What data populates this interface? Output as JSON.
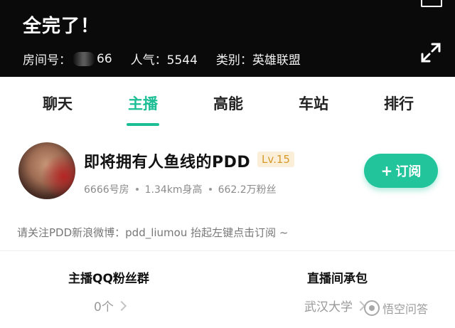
{
  "header": {
    "title": "全完了！",
    "room_label": "房间号：",
    "room_suffix": "66",
    "popularity": "人气：5544",
    "category": "类别：英雄联盟"
  },
  "tabs": [
    {
      "label": "聊天"
    },
    {
      "label": "主播"
    },
    {
      "label": "高能"
    },
    {
      "label": "车站"
    },
    {
      "label": "排行"
    }
  ],
  "active_tab": "主播",
  "streamer": {
    "name": "即将拥有人鱼线的PDD",
    "level": "Lv.15",
    "room_no": "6666号房",
    "height": "1.34km身高",
    "fans": "662.2万粉丝",
    "subscribe_label": "订阅"
  },
  "notice": "请关注PDD新浪微博：pdd_liumou 抬起左键点击订阅 ~",
  "info": {
    "qq_group_title": "主播QQ粉丝群",
    "qq_group_value": "0个",
    "sponsor_title": "直播间承包",
    "sponsor_value": "武汉大学"
  },
  "watermark": "悟空问答",
  "colors": {
    "accent": "#1cbf95",
    "header_bg": "#0a0a0a",
    "level_badge_bg": "#fbefd9",
    "level_badge_text": "#d49a2a"
  }
}
